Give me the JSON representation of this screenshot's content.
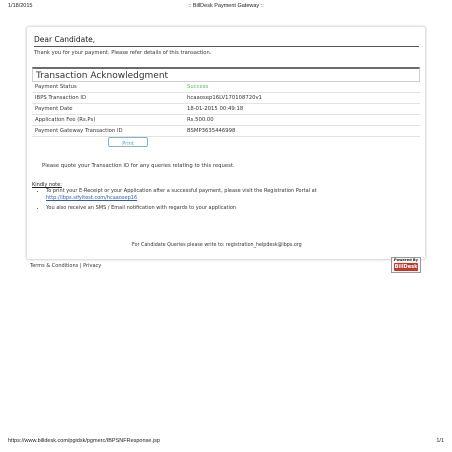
{
  "print_header": {
    "date": "1/18/2015",
    "title": ":: BillDesk Payment Gateway ::"
  },
  "print_footer": {
    "url": "https://www.billdesk.com/pgidsk/pgmerc/IBPSNFResponse.jsp",
    "page": "1/1"
  },
  "greeting": "Dear Candidate,",
  "thanks": "Thank you for your payment. Please refer details of this transaction.",
  "ack_title": "Transaction Acknowledgment",
  "details": [
    {
      "label": "Payment Status",
      "value": "Success"
    },
    {
      "label": "IBPS Transaction ID",
      "value": "hcaaosep16LV170108720v1"
    },
    {
      "label": "Payment Date",
      "value": "18-01-2015 00:49:18"
    },
    {
      "label": "Application Fee (Rs.Ps)",
      "value": "Rs.500.00"
    },
    {
      "label": "Payment Gateway Transaction ID",
      "value": "BSMP3635446998"
    }
  ],
  "print_button": "Print",
  "quote_note": "Please quote your Transaction ID for any queries relating to this request.",
  "kindly_note": "Kindly note:",
  "notes": {
    "item1_text": "To print your E-Receipt or your Application after a successful payment, please visit the Registration Portal at",
    "item1_link": "http://ibps.sifyitest.com/hcaaosep16",
    "item2_text": "You also receive an SMS / Email notification with regards to your application"
  },
  "queries": "For Candidate Queries please write to: registration_helpdesk@ibps.org",
  "terms": "Terms & Conditions | Privacy",
  "powered": {
    "label": "Powered By",
    "logo": "BillDesk"
  },
  "colors": {
    "success": "#5cb85c",
    "link": "#2a5db0",
    "logo_bg": "#c0392b",
    "button_border": "#7fb5c8"
  }
}
